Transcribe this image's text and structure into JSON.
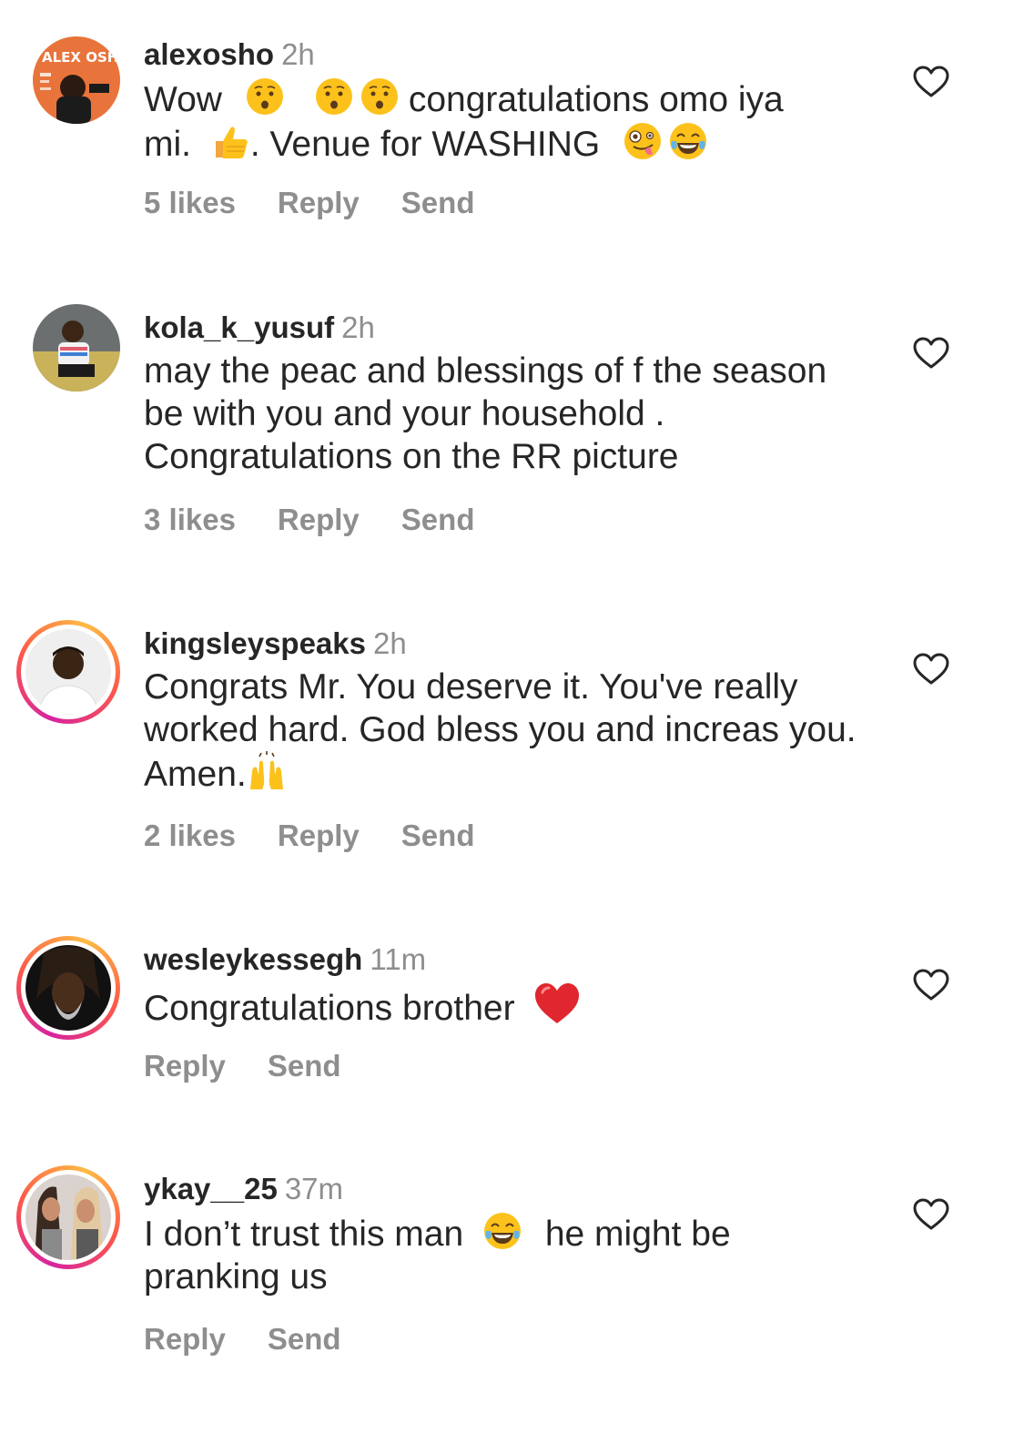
{
  "comments": [
    {
      "username": "alexosho",
      "time": "2h",
      "text_parts": {
        "p1": "Wow",
        "p2": "congratulations omo iya",
        "p3": "mi.",
        "p4": ". Venue for WASHING"
      },
      "likes": "5 likes",
      "reply": "Reply",
      "send": "Send",
      "avatar_text": "ALEX OSHO"
    },
    {
      "username": "kola_k_yusuf",
      "time": "2h",
      "text": "may the peac and blessings of f the season be with you and your household . Congratulations on the RR picture",
      "likes": "3 likes",
      "reply": "Reply",
      "send": "Send"
    },
    {
      "username": "kingsleyspeaks",
      "time": "2h",
      "text": "Congrats Mr.  You deserve it. You've really worked hard. God bless you and increas you. Amen.",
      "likes": "2 likes",
      "reply": "Reply",
      "send": "Send"
    },
    {
      "username": "wesleykessegh",
      "time": "11m",
      "text": "Congratulations brother",
      "reply": "Reply",
      "send": "Send"
    },
    {
      "username": "ykay__25",
      "time": "37m",
      "text_parts": {
        "p1": "I don’t trust this man",
        "p2": "he might be pranking us"
      },
      "reply": "Reply",
      "send": "Send"
    }
  ],
  "icons": {
    "like": "heart-outline-icon",
    "hushed": "hushed-face-emoji",
    "thumbs": "thumbs-up-emoji",
    "zany": "zany-face-emoji",
    "joy": "tears-of-joy-emoji",
    "raised_hands": "raised-hands-emoji",
    "red_heart": "red-heart-emoji"
  },
  "colors": {
    "text": "#262626",
    "secondary": "#8e8e8e",
    "story_ring_start": "#d6249f",
    "story_ring_end": "#fdbc45"
  }
}
